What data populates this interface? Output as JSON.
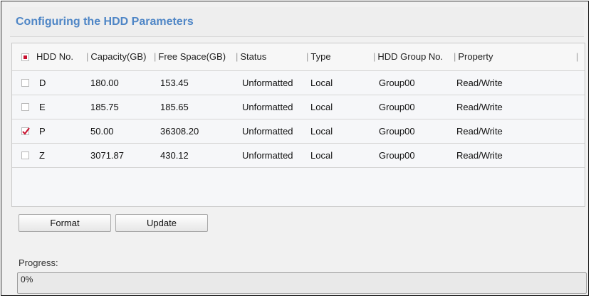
{
  "title": "Configuring the HDD Parameters",
  "table": {
    "header_checkbox_state": "partial",
    "columns": [
      "HDD No.",
      "Capacity(GB)",
      "Free Space(GB)",
      "Status",
      "Type",
      "HDD Group No.",
      "Property"
    ],
    "rows": [
      {
        "checked": false,
        "hdd_no": "D",
        "capacity": "180.00",
        "free_space": "153.45",
        "status": "Unformatted",
        "type": "Local",
        "group": "Group00",
        "property": "Read/Write"
      },
      {
        "checked": false,
        "hdd_no": "E",
        "capacity": "185.75",
        "free_space": "185.65",
        "status": "Unformatted",
        "type": "Local",
        "group": "Group00",
        "property": "Read/Write"
      },
      {
        "checked": true,
        "hdd_no": "P",
        "capacity": "50.00",
        "free_space": "36308.20",
        "status": "Unformatted",
        "type": "Local",
        "group": "Group00",
        "property": "Read/Write"
      },
      {
        "checked": false,
        "hdd_no": "Z",
        "capacity": "3071.87",
        "free_space": "430.12",
        "status": "Unformatted",
        "type": "Local",
        "group": "Group00",
        "property": "Read/Write"
      }
    ]
  },
  "buttons": {
    "format": "Format",
    "update": "Update"
  },
  "progress": {
    "label": "Progress:",
    "value_text": "0%",
    "fraction": 0
  },
  "colors": {
    "title": "#4f86c6",
    "check_mark": "#c8102e"
  }
}
